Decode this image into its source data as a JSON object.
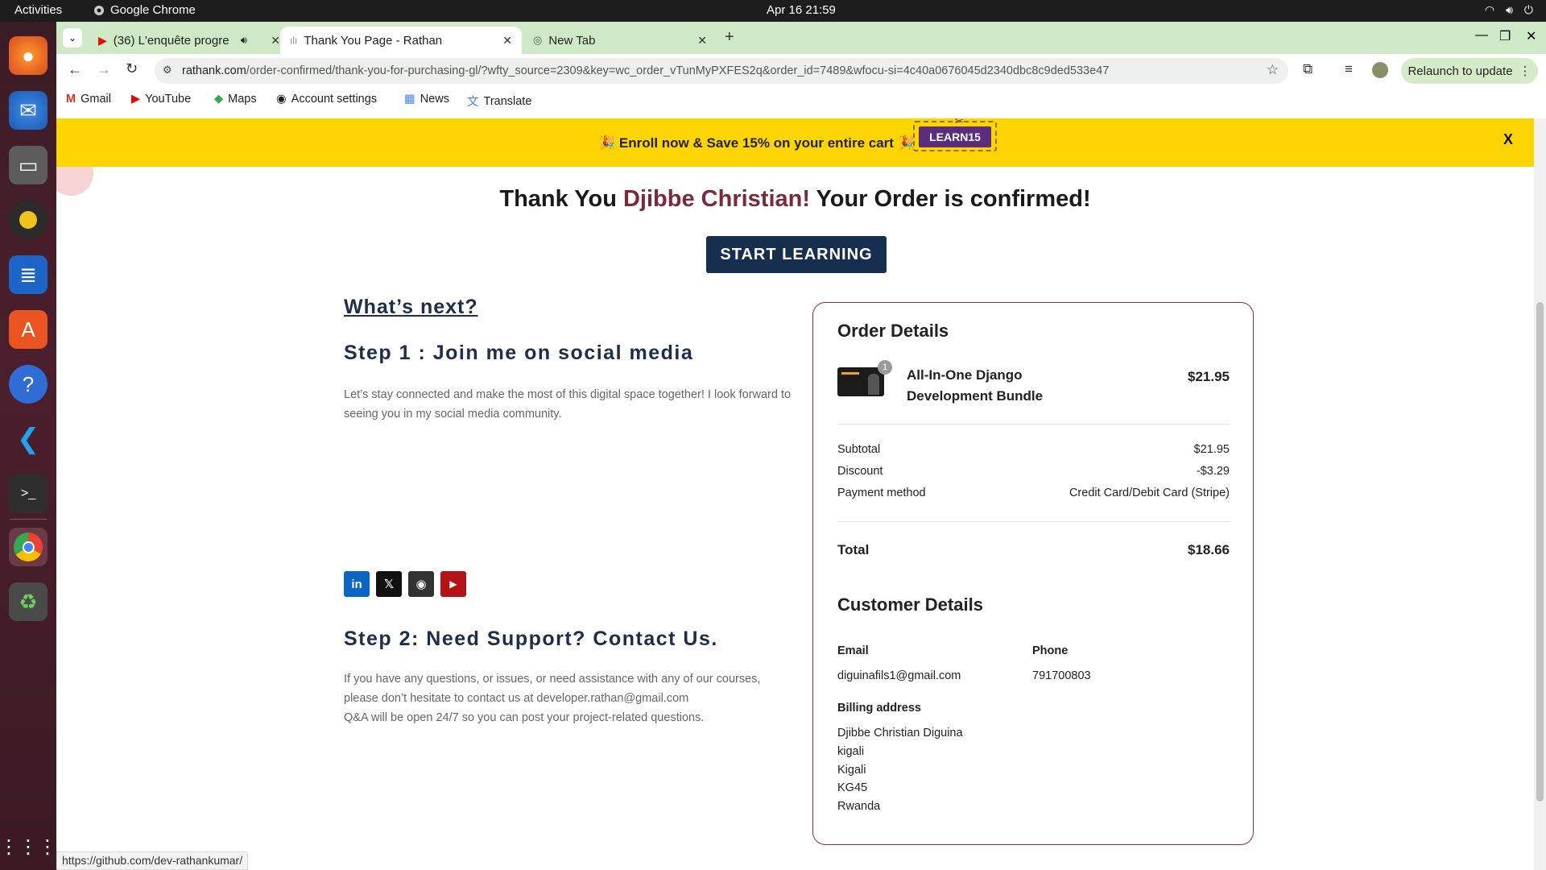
{
  "system": {
    "activities": "Activities",
    "app_name": "Google Chrome",
    "clock": "Apr 16  21:59"
  },
  "tabs": [
    {
      "title": "(36) L'enquête progre",
      "icon": "youtube-icon",
      "audio": true
    },
    {
      "title": "Thank You Page - Rathan",
      "icon": "page-icon",
      "active": true
    },
    {
      "title": "New Tab",
      "icon": "chrome-icon"
    }
  ],
  "omnibox": {
    "domain": "rathank.com",
    "path": "/order-confirmed/thank-you-for-purchasing-gl/?wfty_source=2309&key=wc_order_vTunMyPXFES2q&order_id=7489&wfocu-si=4c40a0676045d2340dbc8c9ded533e47"
  },
  "relaunch_label": "Relaunch to update",
  "bookmarks": [
    {
      "label": "Gmail",
      "icon": "gmail-icon"
    },
    {
      "label": "YouTube",
      "icon": "youtube-icon"
    },
    {
      "label": "Maps",
      "icon": "maps-icon"
    },
    {
      "label": "Account settings",
      "icon": "github-icon"
    },
    {
      "label": "News",
      "icon": "news-icon"
    },
    {
      "label": "Translate",
      "icon": "translate-icon"
    }
  ],
  "promo": {
    "message": "🎉 Enroll now & Save 15% on your entire cart 🎉",
    "code": "LEARN15",
    "close": "X"
  },
  "hero": {
    "prefix": "Thank You ",
    "name": "Djibbe Christian!",
    "suffix": " Your Order is confirmed!",
    "button": "START LEARNING"
  },
  "next": {
    "heading": "What’s next?",
    "step1_title": "Step 1 : Join me on social media",
    "step1_text": "Let’s stay connected and make the most of this digital space together! I look forward to seeing you in my social media community.",
    "social": [
      {
        "name": "linkedin-icon",
        "glyph": "in",
        "color": "#0a66c2"
      },
      {
        "name": "x-icon",
        "glyph": "𝕏",
        "color": "#111111"
      },
      {
        "name": "github-icon",
        "glyph": "◉",
        "color": "#333333"
      },
      {
        "name": "youtube-icon",
        "glyph": "▶",
        "color": "#b31217"
      }
    ],
    "step2_title": "Step 2: Need Support? Contact Us.",
    "step2_line1": "If you have any questions, or issues, or need assistance with any of our courses,",
    "step2_line2": "please don’t hesitate to contact us at developer.rathan@gmail.com",
    "step2_line3": "Q&A will be open 24/7 so you can post your project-related questions."
  },
  "order": {
    "title": "Order Details",
    "qty_badge": "1",
    "product_line1": "All-In-One Django",
    "product_line2": "Development Bundle",
    "product_price": "$21.95",
    "subtotal_label": "Subtotal",
    "subtotal": "$21.95",
    "discount_label": "Discount",
    "discount": "-$3.29",
    "payment_label": "Payment method",
    "payment": "Credit Card/Debit Card (Stripe)",
    "total_label": "Total",
    "total": "$18.66"
  },
  "customer": {
    "title": "Customer Details",
    "email_label": "Email",
    "email": "diguinafils1@gmail.com",
    "phone_label": "Phone",
    "phone": "791700803",
    "billing_label": "Billing address",
    "billing": [
      "Djibbe Christian Diguina",
      "kigali",
      "Kigali",
      "KG45",
      "Rwanda"
    ]
  },
  "status_url": "https://github.com/dev-rathankumar/"
}
